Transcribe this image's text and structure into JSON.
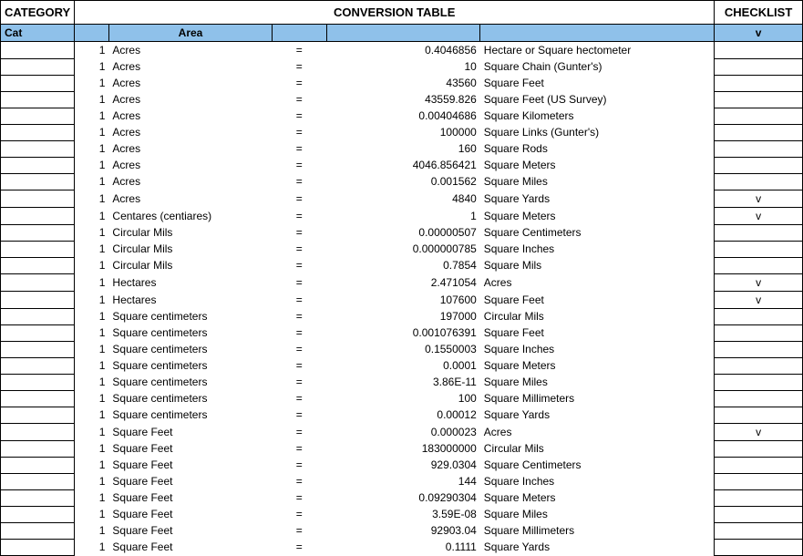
{
  "headers": {
    "category": "CATEGORY",
    "conversion": "CONVERSION TABLE",
    "checklist": "CHECKLIST"
  },
  "subheaders": {
    "cat": "Cat",
    "area": "Area",
    "check": "v"
  },
  "rows": [
    {
      "cat": "",
      "qty": "1",
      "from": "Acres",
      "eq": "=",
      "val": "0.4046856",
      "to": "Hectare or Square hectometer",
      "check": ""
    },
    {
      "cat": "",
      "qty": "1",
      "from": "Acres",
      "eq": "=",
      "val": "10",
      "to": "Square Chain (Gunter's)",
      "check": ""
    },
    {
      "cat": "",
      "qty": "1",
      "from": "Acres",
      "eq": "=",
      "val": "43560",
      "to": "Square Feet",
      "check": ""
    },
    {
      "cat": "",
      "qty": "1",
      "from": "Acres",
      "eq": "=",
      "val": "43559.826",
      "to": "Square Feet (US Survey)",
      "check": ""
    },
    {
      "cat": "",
      "qty": "1",
      "from": "Acres",
      "eq": "=",
      "val": "0.00404686",
      "to": "Square Kilometers",
      "check": ""
    },
    {
      "cat": "",
      "qty": "1",
      "from": "Acres",
      "eq": "=",
      "val": "100000",
      "to": "Square Links (Gunter's)",
      "check": ""
    },
    {
      "cat": "",
      "qty": "1",
      "from": "Acres",
      "eq": "=",
      "val": "160",
      "to": "Square Rods",
      "check": ""
    },
    {
      "cat": "",
      "qty": "1",
      "from": "Acres",
      "eq": "=",
      "val": "4046.856421",
      "to": "Square Meters",
      "check": ""
    },
    {
      "cat": "",
      "qty": "1",
      "from": "Acres",
      "eq": "=",
      "val": "0.001562",
      "to": "Square Miles",
      "check": ""
    },
    {
      "cat": "",
      "qty": "1",
      "from": "Acres",
      "eq": "=",
      "val": "4840",
      "to": "Square Yards",
      "check": "v"
    },
    {
      "cat": "",
      "qty": "1",
      "from": "Centares (centiares)",
      "eq": "=",
      "val": "1",
      "to": "Square Meters",
      "check": "v"
    },
    {
      "cat": "",
      "qty": "1",
      "from": "Circular Mils",
      "eq": "=",
      "val": "0.00000507",
      "to": "Square Centimeters",
      "check": ""
    },
    {
      "cat": "",
      "qty": "1",
      "from": "Circular Mils",
      "eq": "=",
      "val": "0.000000785",
      "to": "Square Inches",
      "check": ""
    },
    {
      "cat": "",
      "qty": "1",
      "from": "Circular Mils",
      "eq": "=",
      "val": "0.7854",
      "to": "Square Mils",
      "check": ""
    },
    {
      "cat": "",
      "qty": "1",
      "from": "Hectares",
      "eq": "=",
      "val": "2.471054",
      "to": "Acres",
      "check": "v"
    },
    {
      "cat": "",
      "qty": "1",
      "from": "Hectares",
      "eq": "=",
      "val": "107600",
      "to": "Square Feet",
      "check": "v"
    },
    {
      "cat": "",
      "qty": "1",
      "from": "Square centimeters",
      "eq": "=",
      "val": "197000",
      "to": "Circular Mils",
      "check": ""
    },
    {
      "cat": "",
      "qty": "1",
      "from": "Square centimeters",
      "eq": "=",
      "val": "0.001076391",
      "to": "Square Feet",
      "check": ""
    },
    {
      "cat": "",
      "qty": "1",
      "from": "Square centimeters",
      "eq": "=",
      "val": "0.1550003",
      "to": "Square Inches",
      "check": ""
    },
    {
      "cat": "",
      "qty": "1",
      "from": "Square centimeters",
      "eq": "=",
      "val": "0.0001",
      "to": "Square Meters",
      "check": ""
    },
    {
      "cat": "",
      "qty": "1",
      "from": "Square centimeters",
      "eq": "=",
      "val": "3.86E-11",
      "to": "Square Miles",
      "check": ""
    },
    {
      "cat": "",
      "qty": "1",
      "from": "Square centimeters",
      "eq": "=",
      "val": "100",
      "to": "Square Millimeters",
      "check": ""
    },
    {
      "cat": "",
      "qty": "1",
      "from": "Square centimeters",
      "eq": "=",
      "val": "0.00012",
      "to": "Square Yards",
      "check": ""
    },
    {
      "cat": "",
      "qty": "1",
      "from": "Square Feet",
      "eq": "=",
      "val": "0.000023",
      "to": "Acres",
      "check": "v"
    },
    {
      "cat": "",
      "qty": "1",
      "from": "Square Feet",
      "eq": "=",
      "val": "183000000",
      "to": "Circular Mils",
      "check": ""
    },
    {
      "cat": "",
      "qty": "1",
      "from": "Square Feet",
      "eq": "=",
      "val": "929.0304",
      "to": "Square Centimeters",
      "check": ""
    },
    {
      "cat": "",
      "qty": "1",
      "from": "Square Feet",
      "eq": "=",
      "val": "144",
      "to": "Square Inches",
      "check": ""
    },
    {
      "cat": "",
      "qty": "1",
      "from": "Square Feet",
      "eq": "=",
      "val": "0.09290304",
      "to": "Square Meters",
      "check": ""
    },
    {
      "cat": "",
      "qty": "1",
      "from": "Square Feet",
      "eq": "=",
      "val": "3.59E-08",
      "to": "Square Miles",
      "check": ""
    },
    {
      "cat": "",
      "qty": "1",
      "from": "Square Feet",
      "eq": "=",
      "val": "92903.04",
      "to": "Square Millimeters",
      "check": ""
    },
    {
      "cat": "",
      "qty": "1",
      "from": "Square Feet",
      "eq": "=",
      "val": "0.1111",
      "to": "Square Yards",
      "check": ""
    }
  ]
}
